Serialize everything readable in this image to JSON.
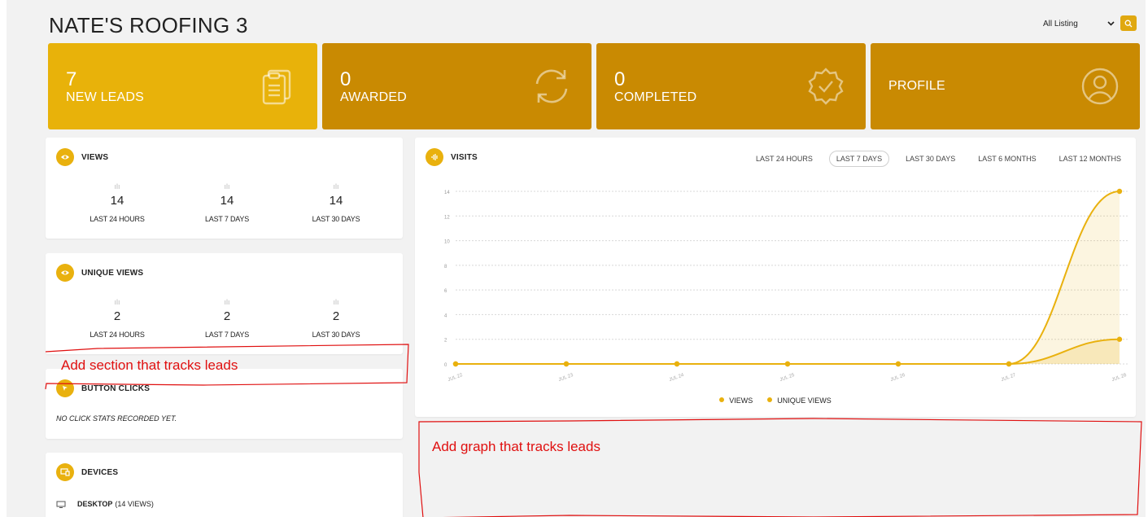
{
  "header": {
    "title": "NATE'S ROOFING 3",
    "listing_select": "All Listing"
  },
  "colors": {
    "card_bright": "#e8b20a",
    "card_dark": "#c98a02",
    "accent": "#e9b10e"
  },
  "cards": [
    {
      "number": "7",
      "label": "NEW LEADS",
      "icon": "clipboard-icon"
    },
    {
      "number": "0",
      "label": "AWARDED",
      "icon": "refresh-icon"
    },
    {
      "number": "0",
      "label": "COMPLETED",
      "icon": "badge-check-icon"
    },
    {
      "number": "",
      "label": "PROFILE",
      "icon": "user-circle-icon"
    }
  ],
  "views": {
    "title": "VIEWS",
    "metrics": [
      {
        "value": "14",
        "label": "LAST 24 HOURS"
      },
      {
        "value": "14",
        "label": "LAST 7 DAYS"
      },
      {
        "value": "14",
        "label": "LAST 30 DAYS"
      }
    ]
  },
  "unique_views": {
    "title": "UNIQUE VIEWS",
    "metrics": [
      {
        "value": "2",
        "label": "LAST 24 HOURS"
      },
      {
        "value": "2",
        "label": "LAST 7 DAYS"
      },
      {
        "value": "2",
        "label": "LAST 30 DAYS"
      }
    ]
  },
  "button_clicks": {
    "title": "BUTTON CLICKS",
    "empty": "NO CLICK STATS RECORDED YET."
  },
  "devices": {
    "title": "DEVICES",
    "item_name": "DESKTOP",
    "item_count": "(14 VIEWS)"
  },
  "visits": {
    "title": "VISITS",
    "tabs": [
      "LAST 24 HOURS",
      "LAST 7 DAYS",
      "LAST 30 DAYS",
      "LAST 6 MONTHS",
      "LAST 12 MONTHS"
    ],
    "active_tab": "LAST 7 DAYS"
  },
  "chart_data": {
    "type": "line",
    "x": [
      "JUL 22",
      "JUL 23",
      "JUL 24",
      "JUL 25",
      "JUL 26",
      "JUL 27",
      "JUL 28"
    ],
    "series": [
      {
        "name": "VIEWS",
        "values": [
          0,
          0,
          0,
          0,
          0,
          0,
          14
        ]
      },
      {
        "name": "UNIQUE VIEWS",
        "values": [
          0,
          0,
          0,
          0,
          0,
          0,
          2
        ]
      }
    ],
    "yticks": [
      0,
      2,
      4,
      6,
      8,
      10,
      12,
      14
    ],
    "ylim": [
      0,
      14
    ],
    "grid": true,
    "legend": "bottom"
  },
  "annotations": {
    "leads_section": "Add section that tracks leads",
    "leads_graph": "Add graph that tracks leads"
  }
}
